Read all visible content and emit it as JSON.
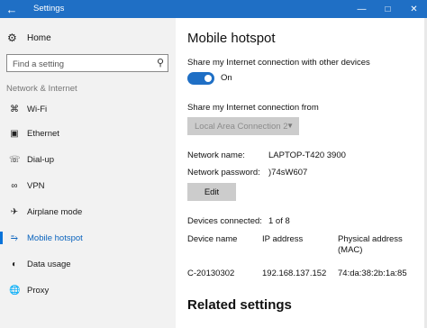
{
  "window": {
    "title": "Settings",
    "back_icon": "arrow-left",
    "controls": {
      "minimize": "minimize-icon",
      "maximize": "maximize-icon",
      "close": "close-icon"
    },
    "accent_color": "#1f6fc5"
  },
  "sidebar": {
    "home_label": "Home",
    "search_placeholder": "Find a setting",
    "group_title": "Network & Internet",
    "items": [
      {
        "label": "Wi-Fi",
        "icon": "wifi-icon",
        "active": false
      },
      {
        "label": "Ethernet",
        "icon": "ethernet-icon",
        "active": false
      },
      {
        "label": "Dial-up",
        "icon": "dialup-icon",
        "active": false
      },
      {
        "label": "VPN",
        "icon": "vpn-icon",
        "active": false
      },
      {
        "label": "Airplane mode",
        "icon": "airplane-icon",
        "active": false
      },
      {
        "label": "Mobile hotspot",
        "icon": "hotspot-icon",
        "active": true
      },
      {
        "label": "Data usage",
        "icon": "data-usage-icon",
        "active": false
      },
      {
        "label": "Proxy",
        "icon": "proxy-icon",
        "active": false
      }
    ]
  },
  "main": {
    "title": "Mobile hotspot",
    "share_label": "Share my Internet connection with other devices",
    "toggle_state": "On",
    "share_from_label": "Share my Internet connection from",
    "share_from_value": "Local Area Connection 2",
    "network_name_label": "Network name:",
    "network_name_value": "LAPTOP-T420 3900",
    "network_password_label": "Network password:",
    "network_password_value": ")74sW607",
    "edit_label": "Edit",
    "devices_connected_label": "Devices connected:",
    "devices_connected_value": "1 of 8",
    "table": {
      "headers": [
        "Device name",
        "IP address",
        "Physical address (MAC)"
      ],
      "rows": [
        [
          "C-20130302",
          "192.168.137.152",
          "74:da:38:2b:1a:85"
        ]
      ]
    },
    "related_title": "Related settings"
  }
}
